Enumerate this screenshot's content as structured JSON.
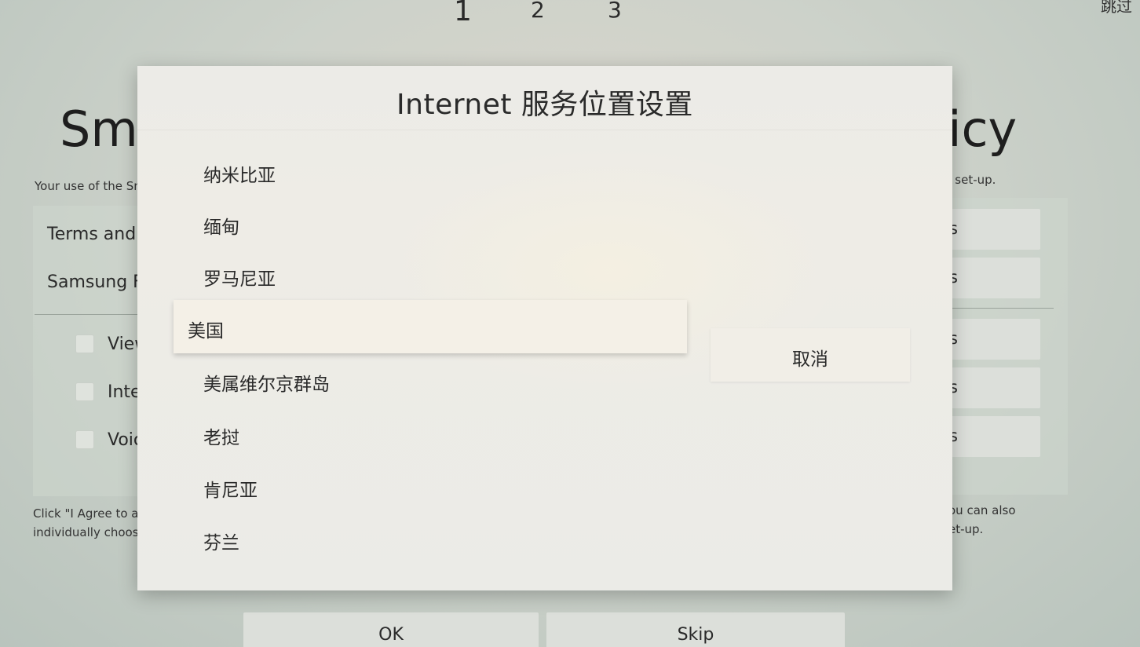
{
  "steps": [
    "1",
    "2",
    "3"
  ],
  "top_skip": "跳过",
  "background": {
    "title_left": "Sma",
    "title_right": "licy",
    "subtitle_left": "Your use of the Sn",
    "subtitle_right": "h set-up.",
    "rows_left": [
      "Terms and",
      "Samsung F"
    ],
    "checkbox_labels": [
      "View",
      "Inte",
      "Voic"
    ],
    "right_buttons": [
      "s",
      "s",
      "s",
      "s",
      "s"
    ],
    "footer_left": [
      "Click \"I Agree to al",
      "individually choos"
    ],
    "footer_right": [
      "ou can also",
      "et-up."
    ],
    "ok_label": "OK",
    "skip_label": "Skip"
  },
  "dialog": {
    "title": "Internet 服务位置设置",
    "items": [
      {
        "label": "纳米比亚",
        "selected": false
      },
      {
        "label": "缅甸",
        "selected": false
      },
      {
        "label": "罗马尼亚",
        "selected": false
      },
      {
        "label": "美国",
        "selected": true
      },
      {
        "label": "美属维尔京群岛",
        "selected": false
      },
      {
        "label": "老挝",
        "selected": false
      },
      {
        "label": "肯尼亚",
        "selected": false
      },
      {
        "label": "芬兰",
        "selected": false
      }
    ],
    "cancel_label": "取消"
  }
}
